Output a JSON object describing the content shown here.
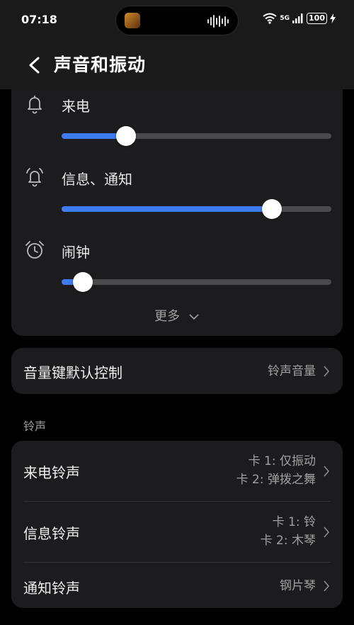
{
  "status_bar": {
    "time": "07:18",
    "network": "5G",
    "battery": "100"
  },
  "header": {
    "title": "声音和振动"
  },
  "volume": {
    "items": [
      {
        "label": "来电",
        "icon": "bell-icon",
        "level": 0.24
      },
      {
        "label": "信息、通知",
        "icon": "bell-ring-icon",
        "level": 0.78
      },
      {
        "label": "闹钟",
        "icon": "alarm-clock-icon",
        "level": 0.08
      }
    ],
    "more_label": "更多",
    "accent_color": "#3d7bf0"
  },
  "volume_key": {
    "label": "音量键默认控制",
    "value": "铃声音量"
  },
  "ringtone_section": {
    "title": "铃声"
  },
  "ringtones": [
    {
      "label": "来电铃声",
      "values": [
        "卡 1: 仅振动",
        "卡 2: 弹拨之舞"
      ]
    },
    {
      "label": "信息铃声",
      "values": [
        "卡 1: 铃",
        "卡 2: 木琴"
      ]
    },
    {
      "label": "通知铃声",
      "values": [
        "钢片琴"
      ]
    }
  ]
}
